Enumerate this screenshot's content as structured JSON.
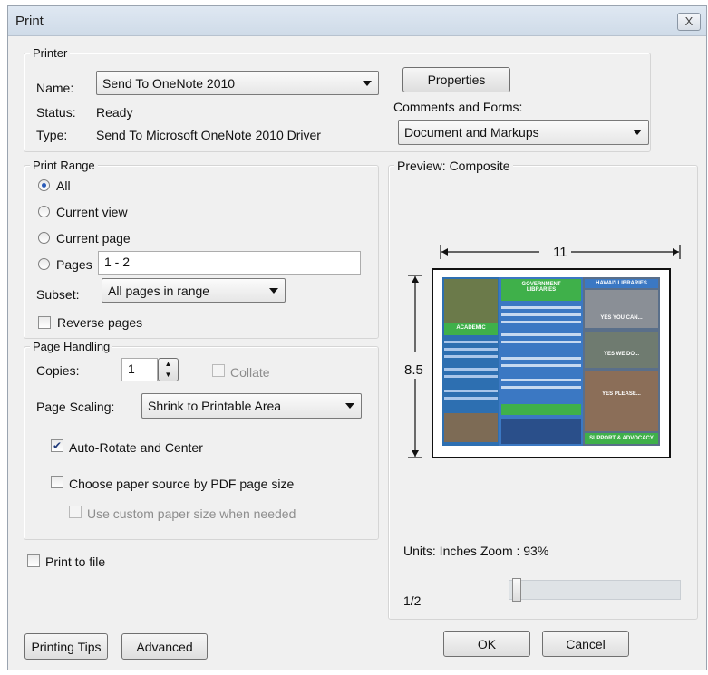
{
  "window": {
    "title": "Print",
    "close_label": "X"
  },
  "printer": {
    "legend": "Printer",
    "name_label": "Name:",
    "name_value": "Send To OneNote 2010",
    "properties_label": "Properties",
    "status_label": "Status:",
    "status_value": "Ready",
    "type_label": "Type:",
    "type_value": "Send To Microsoft OneNote 2010 Driver",
    "comments_label": "Comments and Forms:",
    "comments_value": "Document and Markups"
  },
  "print_range": {
    "legend": "Print Range",
    "options": [
      {
        "label": "All",
        "selected": true
      },
      {
        "label": "Current view",
        "selected": false
      },
      {
        "label": "Current page",
        "selected": false
      },
      {
        "label": "Pages",
        "selected": false
      }
    ],
    "pages_value": "1 - 2",
    "subset_label": "Subset:",
    "subset_value": "All pages in range",
    "reverse_label": "Reverse pages",
    "reverse_checked": false
  },
  "page_handling": {
    "legend": "Page Handling",
    "copies_label": "Copies:",
    "copies_value": "1",
    "collate_label": "Collate",
    "scaling_label": "Page Scaling:",
    "scaling_value": "Shrink to Printable Area",
    "auto_rotate_label": "Auto-Rotate and Center",
    "auto_rotate_checked": true,
    "paper_source_label": "Choose paper source by PDF page size",
    "custom_paper_label": "Use custom paper size when needed"
  },
  "print_to_file_label": "Print to file",
  "preview": {
    "title": "Preview: Composite",
    "width_label": "11",
    "height_label": "8.5",
    "units_zoom": "Units: Inches Zoom : 93%",
    "page_indicator": "1/2",
    "brochure_text": {
      "col2_title": "GOVERNMENT\nLIBRARIES",
      "col1_label": "ACADEMIC",
      "col3_title": "HAWAI'I LIBRARIES",
      "yes_you_can": "YES YOU CAN...",
      "yes_we_do": "YES WE DO...",
      "yes_please": "YES PLEASE...",
      "support": "SUPPORT & ADVOCACY"
    }
  },
  "buttons": {
    "printing_tips": "Printing Tips",
    "advanced": "Advanced",
    "ok": "OK",
    "cancel": "Cancel"
  },
  "colors": {
    "brochure_green": "#3fb04a",
    "brochure_blue": "#3b78c3",
    "radio_dot": "#2a5bb8"
  }
}
